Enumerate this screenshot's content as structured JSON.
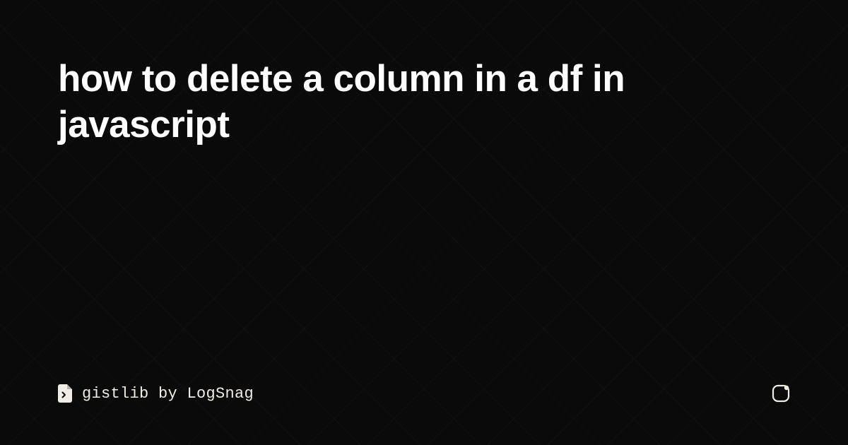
{
  "title": "how to delete a column in a df in javascript",
  "brand": {
    "text": "gistlib by LogSnag"
  },
  "colors": {
    "background": "#0a0a0a",
    "text": "#ffffff",
    "brand_text": "#f0ede6"
  }
}
